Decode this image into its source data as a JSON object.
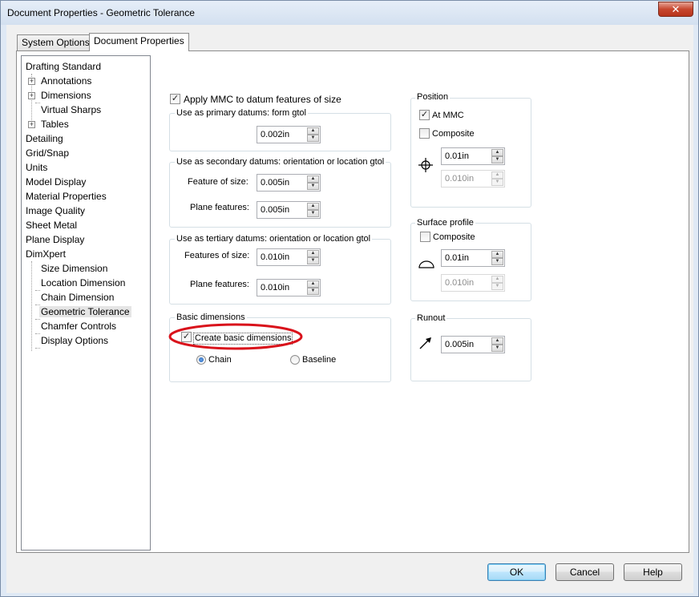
{
  "window": {
    "title": "Document Properties - Geometric Tolerance",
    "close_label": "✕"
  },
  "tabs": [
    {
      "label": "System Options",
      "active": false
    },
    {
      "label": "Document Properties",
      "active": true
    }
  ],
  "tree": {
    "items": [
      {
        "label": "Drafting Standard"
      },
      {
        "label": "Annotations"
      },
      {
        "label": "Dimensions"
      },
      {
        "label": "Virtual Sharps"
      },
      {
        "label": "Tables"
      },
      {
        "label": "Detailing"
      },
      {
        "label": "Grid/Snap"
      },
      {
        "label": "Units"
      },
      {
        "label": "Model Display"
      },
      {
        "label": "Material Properties"
      },
      {
        "label": "Image Quality"
      },
      {
        "label": "Sheet Metal"
      },
      {
        "label": "Plane Display"
      },
      {
        "label": "DimXpert"
      },
      {
        "label": "Size Dimension"
      },
      {
        "label": "Location Dimension"
      },
      {
        "label": "Chain Dimension"
      },
      {
        "label": "Geometric Tolerance"
      },
      {
        "label": "Chamfer Controls"
      },
      {
        "label": "Display Options"
      }
    ],
    "expander_symbol": "+",
    "selected": "Geometric Tolerance"
  },
  "apply_mmc": {
    "label": "Apply MMC to datum features of size",
    "checked": true
  },
  "primary": {
    "title": "Use as primary datums: form gtol",
    "value": "0.002in"
  },
  "secondary": {
    "title": "Use as secondary datums: orientation or location gtol",
    "size_label": "Feature of size:",
    "size_value": "0.005in",
    "plane_label": "Plane features:",
    "plane_value": "0.005in"
  },
  "tertiary": {
    "title": "Use as tertiary datums: orientation or location gtol",
    "size_label": "Features of size:",
    "size_value": "0.010in",
    "plane_label": "Plane features:",
    "plane_value": "0.010in"
  },
  "basic": {
    "title": "Basic dimensions",
    "create_label": "Create basic dimensions",
    "create_checked": true,
    "chain_label": "Chain",
    "chain_selected": true,
    "baseline_label": "Baseline",
    "baseline_selected": false
  },
  "position": {
    "title": "Position",
    "at_mmc_label": "At MMC",
    "at_mmc_checked": true,
    "composite_label": "Composite",
    "composite_checked": false,
    "value1": "0.01in",
    "value2": "0.010in",
    "icon": "position-icon"
  },
  "surface_profile": {
    "title": "Surface profile",
    "composite_label": "Composite",
    "composite_checked": false,
    "value1": "0.01in",
    "value2": "0.010in",
    "icon": "surface-profile-icon"
  },
  "runout": {
    "title": "Runout",
    "value": "0.005in",
    "icon": "runout-icon"
  },
  "buttons": {
    "ok": "OK",
    "cancel": "Cancel",
    "help": "Help"
  },
  "annotation_color": "#d9121b",
  "check_glyph": "✓",
  "spin_up_glyph": "▲",
  "spin_down_glyph": "▼"
}
